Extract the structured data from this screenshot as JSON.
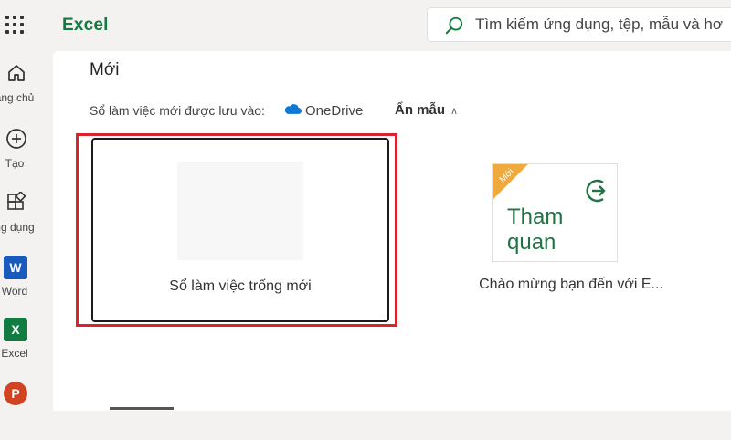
{
  "app": {
    "title": "Excel"
  },
  "search": {
    "placeholder": "Tìm kiếm ứng dụng, tệp, mẫu và hơ"
  },
  "rail": {
    "items": [
      {
        "label": "ang chủ",
        "icon": "home-icon"
      },
      {
        "label": "Tạo",
        "icon": "plus-circle-icon"
      },
      {
        "label": "ng dụng",
        "icon": "apps-icon"
      },
      {
        "label": "Word",
        "icon": "word-icon",
        "letter": "W"
      },
      {
        "label": "Excel",
        "icon": "excel-icon",
        "letter": "X"
      },
      {
        "label": "",
        "icon": "powerpoint-icon",
        "letter": "P"
      }
    ]
  },
  "new_section": {
    "title": "Mới",
    "save_location_label": "Sổ làm việc mới được lưu vào:",
    "save_location": "OneDrive",
    "hide_templates": "Ẩn mẫu",
    "templates": [
      {
        "caption": "Sổ làm việc trống mới"
      },
      {
        "caption": "Chào mừng bạn đến với E...",
        "badge": "Mới",
        "thumb_text": "Tham quan"
      }
    ]
  },
  "colors": {
    "excel_green": "#107c41",
    "highlight_red": "#d9232d",
    "badge_orange": "#f0a93c",
    "onedrive_blue": "#0f78d4"
  }
}
